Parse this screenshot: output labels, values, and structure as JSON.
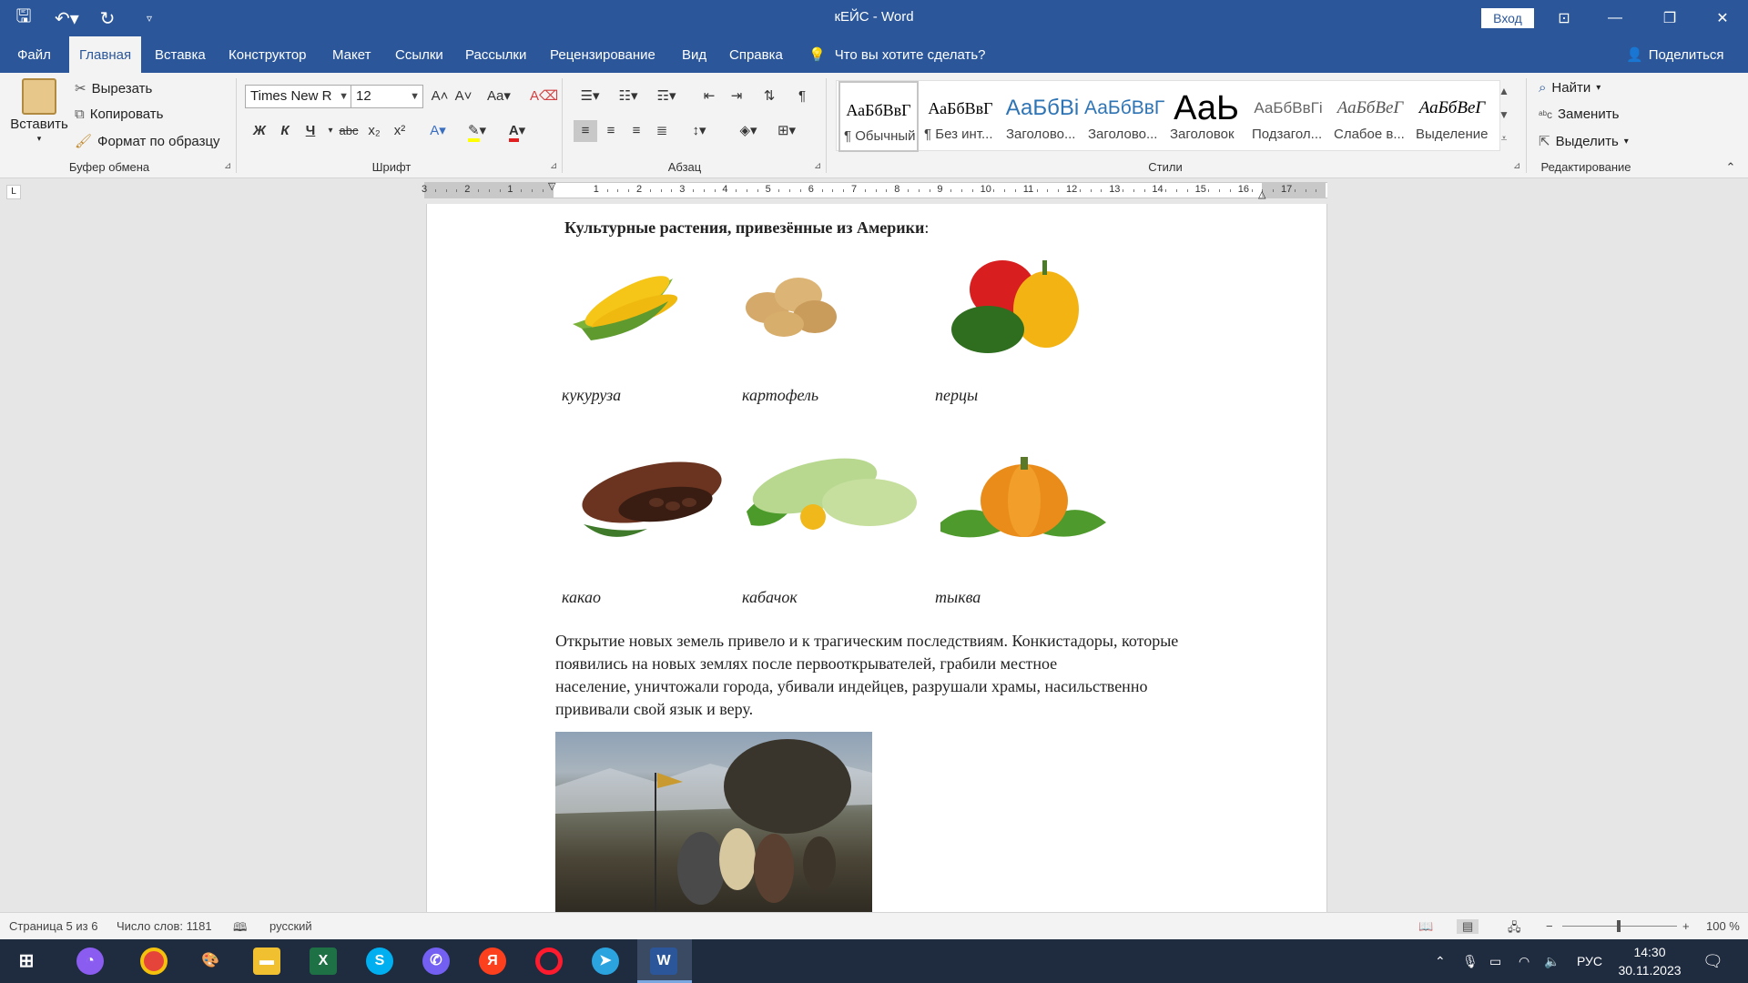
{
  "window": {
    "title": "кЕЙС  -  Word",
    "login_label": "Вход",
    "icons": [
      "save-icon",
      "undo-icon",
      "redo-icon",
      "customize-icon",
      "ribbon-display-icon",
      "minimize-icon",
      "maximize-icon",
      "close-icon"
    ]
  },
  "tabs": [
    "Файл",
    "Главная",
    "Вставка",
    "Конструктор",
    "Макет",
    "Ссылки",
    "Рассылки",
    "Рецензирование",
    "Вид",
    "Справка"
  ],
  "active_tab": "Главная",
  "tellme": "Что вы хотите сделать?",
  "share": "Поделиться",
  "clipboard": {
    "paste": "Вставить",
    "cut": "Вырезать",
    "copy": "Копировать",
    "format_painter": "Формат по образцу",
    "group": "Буфер обмена"
  },
  "font": {
    "name": "Times New R",
    "size": "12",
    "group": "Шрифт",
    "bold": "Ж",
    "italic": "К",
    "underline": "Ч",
    "strike": "abc",
    "sub": "x₂",
    "sup": "x²"
  },
  "paragraph": {
    "group": "Абзац"
  },
  "styles": {
    "group": "Стили",
    "items": [
      {
        "preview": "АаБбВвГ",
        "name": "¶ Обычный"
      },
      {
        "preview": "АаБбВвГ",
        "name": "¶ Без инт..."
      },
      {
        "preview": "АаБбВі",
        "name": "Заголово..."
      },
      {
        "preview": "АаБбВвГ",
        "name": "Заголово..."
      },
      {
        "preview": "АаЬ",
        "name": "Заголовок"
      },
      {
        "preview": "АаБбВвГі",
        "name": "Подзагол..."
      },
      {
        "preview": "АаБбВеГ",
        "name": "Слабое в..."
      },
      {
        "preview": "АаБбВеГ",
        "name": "Выделение"
      }
    ]
  },
  "editing": {
    "group": "Редактирование",
    "find": "Найти",
    "replace": "Заменить",
    "select": "Выделить"
  },
  "ruler": {
    "labels": [
      "3",
      "2",
      "1",
      "1",
      "2",
      "3",
      "4",
      "5",
      "6",
      "7",
      "8",
      "9",
      "10",
      "11",
      "12",
      "13",
      "14",
      "15",
      "16",
      "17"
    ]
  },
  "document": {
    "heading_bold": "Культурные растения, привезённые из Америки",
    "heading_tail": ":",
    "captions_row1": [
      "кукуруза",
      "картофель",
      "перцы"
    ],
    "captions_row2": [
      "какао",
      "кабачок",
      "тыква"
    ],
    "paragraph_lines": [
      "Открытие новых земель привело и к трагическим последствиям. Конкистадоры, которые",
      "появились на новых землях после первооткрывателей, грабили местное",
      "население, уничтожали города, убивали индейцев, разрушали храмы, насильственно",
      "прививали свой язык и веру."
    ]
  },
  "status": {
    "page": "Страница 5 из 6",
    "words": "Число слов: 1181",
    "language": "русский",
    "zoom": "100 %"
  },
  "taskbar": {
    "clock_time": "14:30",
    "clock_date": "30.11.2023",
    "lang": "РУС",
    "apps": [
      "windows-start-icon",
      "alice-icon",
      "chrome-icon",
      "paint-icon",
      "explorer-icon",
      "excel-icon",
      "skype-icon",
      "viber-icon",
      "yandex-icon",
      "opera-icon",
      "telegram-icon",
      "word-icon"
    ]
  }
}
